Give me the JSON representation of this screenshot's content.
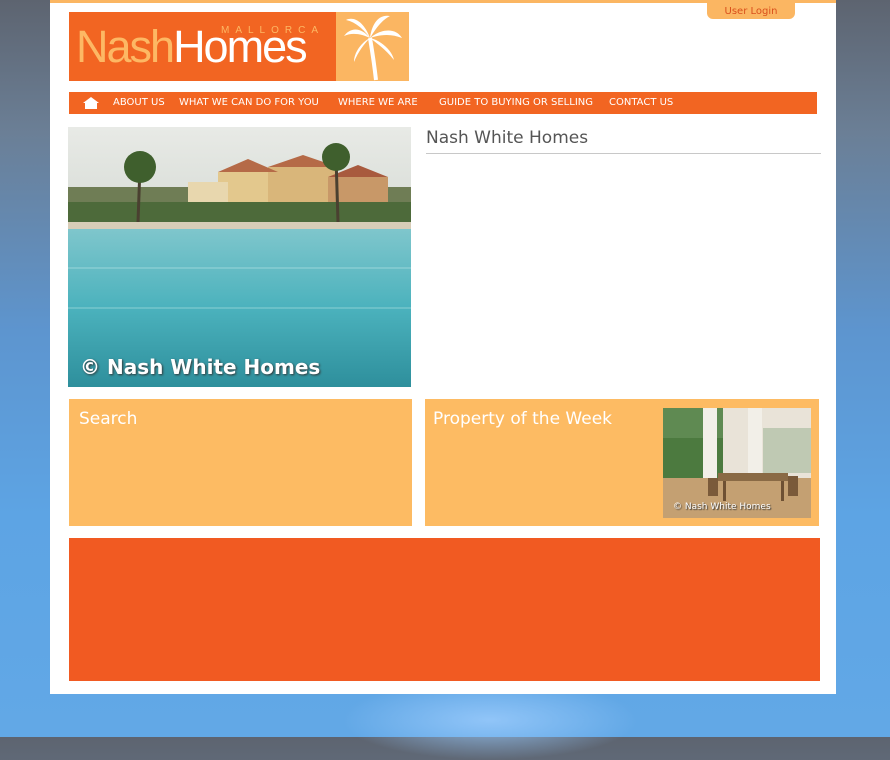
{
  "header": {
    "login_label": "User Login",
    "logo": {
      "word_nash": "Nash",
      "word_homes": "Homes",
      "sub": "MALLORCA"
    }
  },
  "nav": {
    "items": [
      {
        "label": "ABOUT US"
      },
      {
        "label": "WHAT WE CAN DO FOR YOU"
      },
      {
        "label": "WHERE WE ARE"
      },
      {
        "label": "GUIDE TO BUYING OR SELLING"
      },
      {
        "label": "CONTACT US"
      }
    ]
  },
  "hero": {
    "caption": "© Nash White Homes"
  },
  "main": {
    "title": "Nash White Homes"
  },
  "search": {
    "title": "Search"
  },
  "property_of_week": {
    "title": "Property of the Week",
    "caption": "© Nash White Homes"
  },
  "colors": {
    "brand_orange": "#f26522",
    "light_orange": "#fdbb63",
    "footer_orange": "#f15a22"
  },
  "icons": {
    "home": "home-icon",
    "palm": "palm-tree-icon"
  }
}
